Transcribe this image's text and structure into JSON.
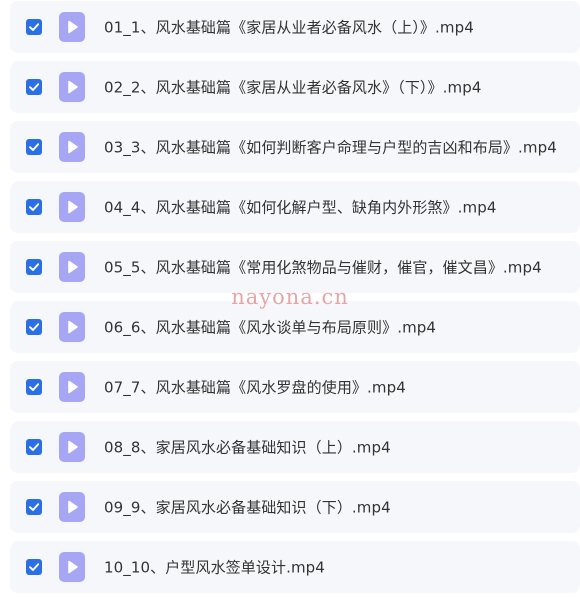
{
  "colors": {
    "checkbox": "#2b6fe7",
    "file_icon": "#a7a6f4",
    "row_background": "#f6f7fa",
    "text": "#333333",
    "watermark": "#e29696"
  },
  "file_icon_name": "video-play-icon",
  "files": [
    {
      "checked": true,
      "name": "01_1、风水基础篇《家居从业者必备风水（上）》.mp4"
    },
    {
      "checked": true,
      "name": "02_2、风水基础篇《家居从业者必备风水》（下）》.mp4"
    },
    {
      "checked": true,
      "name": "03_3、风水基础篇《如何判断客户命理与户型的吉凶和布局》.mp4"
    },
    {
      "checked": true,
      "name": "04_4、风水基础篇《如何化解户型、缺角内外形煞》.mp4"
    },
    {
      "checked": true,
      "name": "05_5、风水基础篇《常用化煞物品与催财，催官，催文昌》.mp4"
    },
    {
      "checked": true,
      "name": "06_6、风水基础篇《风水谈单与布局原则》.mp4"
    },
    {
      "checked": true,
      "name": "07_7、风水基础篇《风水罗盘的使用》.mp4"
    },
    {
      "checked": true,
      "name": "08_8、家居风水必备基础知识（上）.mp4"
    },
    {
      "checked": true,
      "name": "09_9、家居风水必备基础知识（下）.mp4"
    },
    {
      "checked": true,
      "name": "10_10、户型风水签单设计.mp4"
    }
  ],
  "watermark": "nayona.cn"
}
